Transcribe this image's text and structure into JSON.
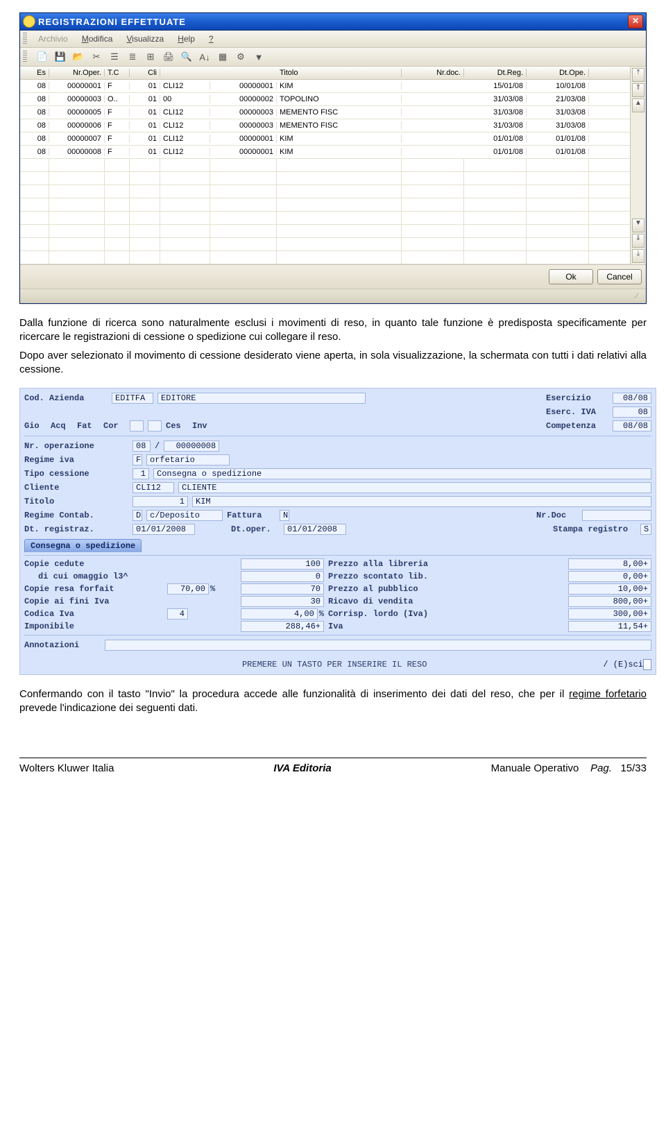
{
  "window1": {
    "title": "REGISTRAZIONI EFFETTUATE",
    "menu": {
      "archivio": "Archivio",
      "modifica": "Modifica",
      "visualizza": "Visualizza",
      "help": "Help",
      "about": "?"
    },
    "headers": {
      "es": "Es",
      "nroper": "Nr.Oper.",
      "tc": "T.C",
      "cli": "Cli",
      "blank": "",
      "col6": "",
      "titolo": "Titolo",
      "nrdoc": "Nr.doc.",
      "dtreg": "Dt.Reg.",
      "dtope": "Dt.Ope."
    },
    "rows": [
      {
        "es": "08",
        "nroper": "00000001",
        "tc": "F",
        "cli": "01",
        "c5": "CLI12",
        "c6": "00000001",
        "titolo": "KIM",
        "nrdoc": "",
        "dtreg": "15/01/08",
        "dtope": "10/01/08"
      },
      {
        "es": "08",
        "nroper": "00000003",
        "tc": "O..",
        "cli": "01",
        "c5": "00",
        "c6": "00000002",
        "titolo": "TOPOLINO",
        "nrdoc": "",
        "dtreg": "31/03/08",
        "dtope": "21/03/08"
      },
      {
        "es": "08",
        "nroper": "00000005",
        "tc": "F",
        "cli": "01",
        "c5": "CLI12",
        "c6": "00000003",
        "titolo": "MEMENTO FISC",
        "nrdoc": "",
        "dtreg": "31/03/08",
        "dtope": "31/03/08"
      },
      {
        "es": "08",
        "nroper": "00000006",
        "tc": "F",
        "cli": "01",
        "c5": "CLI12",
        "c6": "00000003",
        "titolo": "MEMENTO FISC",
        "nrdoc": "",
        "dtreg": "31/03/08",
        "dtope": "31/03/08"
      },
      {
        "es": "08",
        "nroper": "00000007",
        "tc": "F",
        "cli": "01",
        "c5": "CLI12",
        "c6": "00000001",
        "titolo": "KIM",
        "nrdoc": "",
        "dtreg": "01/01/08",
        "dtope": "01/01/08"
      },
      {
        "es": "08",
        "nroper": "00000008",
        "tc": "F",
        "cli": "01",
        "c5": "CLI12",
        "c6": "00000001",
        "titolo": "KIM",
        "nrdoc": "",
        "dtreg": "01/01/08",
        "dtope": "01/01/08"
      }
    ],
    "buttons": {
      "ok": "Ok",
      "cancel": "Cancel"
    }
  },
  "para1": "Dalla funzione di ricerca sono naturalmente esclusi i movimenti di reso, in quanto tale funzione è predisposta specificamente per ricercare le registrazioni di cessione o spedizione cui collegare il reso.",
  "para2": "Dopo aver selezionato il movimento di cessione desiderato viene aperta, in sola visualizzazione, la schermata con  tutti i dati relativi alla cessione.",
  "form": {
    "labels": {
      "codaz": "Cod. Azienda",
      "editfa": "EDITFA",
      "editore": "EDITORE",
      "eserc": "Esercizio",
      "eserciva": "Eserc. IVA",
      "compet": "Competenza",
      "gio": "Gio",
      "acq": "Acq",
      "fat": "Fat",
      "cor": "Cor",
      "ces": "Ces",
      "inv": "Inv",
      "nrop": "Nr. operazione",
      "regiva": "Regime iva",
      "tipoc": "Tipo cessione",
      "cliente": "Cliente",
      "titolo": "Titolo",
      "regcont": "Regime Contab.",
      "fattura": "Fattura",
      "nrdoc": "Nr.Doc",
      "dtreg": "Dt. registraz.",
      "dtoper": "Dt.oper.",
      "stampa": "Stampa registro",
      "tab": "Consegna o spedizione",
      "lines": [
        "Copie cedute",
        "   di cui omaggio l3^",
        "Copie resa forfait",
        "Copie ai fini Iva",
        "Codica Iva",
        "Imponibile"
      ],
      "rights": [
        "Prezzo alla libreria",
        "Prezzo scontato lib.",
        "Prezzo al pubblico",
        "Ricavo di vendita",
        "Corrisp. lordo (Iva)",
        "Iva"
      ],
      "annot": "Annotazioni",
      "prompt": "PREMERE UN TASTO PER INSERIRE IL RESO",
      "esc": "/ (E)sci"
    },
    "vals": {
      "eserc": "08/08",
      "eserciva": "08",
      "compet": "08/08",
      "nropA": "08",
      "nropB": "00000008",
      "regivaA": "F",
      "regivaB": "orfetario",
      "tipocA": "1",
      "tipocB": "Consegna o spedizione",
      "clienteA": "CLI12",
      "clienteB": "CLIENTE",
      "titoloA": "1",
      "titoloB": "KIM",
      "regcontA": "D",
      "regcontB": "c/Deposito",
      "fatturaN": "N",
      "dtreg": "01/01/2008",
      "dtoper": "01/01/2008",
      "stampa": "S",
      "leftvals": [
        "100",
        "0",
        "70",
        "30",
        "4,00",
        "288,46+"
      ],
      "forfait": "70,00",
      "codiva": "4",
      "pct": "%",
      "rightvals": [
        "8,00+",
        "0,00+",
        "10,00+",
        "800,00+",
        "300,00+",
        "11,54+"
      ]
    }
  },
  "para3a": "Confermando con il tasto \"Invio\" la procedura accede alle funzionalità di inserimento dei dati del reso, che per il ",
  "para3u": "regime forfetario",
  "para3b": " prevede l'indicazione dei seguenti dati.",
  "footer": {
    "left": "Wolters Kluwer Italia",
    "mid": "IVA Editoria",
    "rightA": "Manuale Operativo",
    "rightB": "Pag.",
    "rightC": "15/33"
  }
}
